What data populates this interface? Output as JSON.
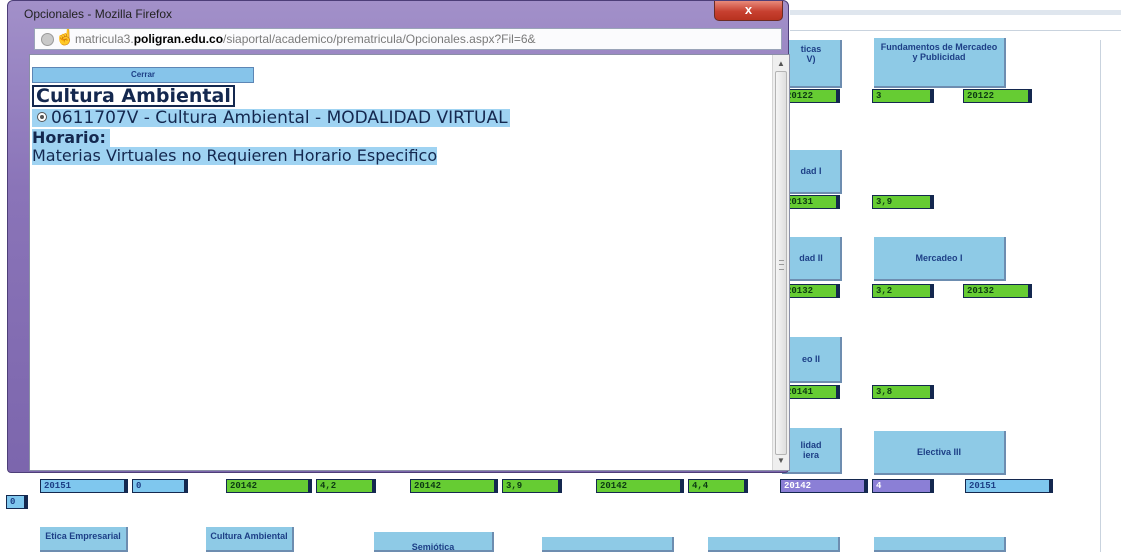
{
  "window": {
    "title": "Opcionales - Mozilla Firefox",
    "close_glyph": "x",
    "url_prefix": "matricula3.",
    "url_domain": "poligran.edu.co",
    "url_path": "/siaportal/academico/prematricula/Opcionales.aspx?Fil=6&"
  },
  "popup": {
    "close_button": "Cerrar",
    "subject_title": "Cultura Ambiental",
    "option_text": "0611707V - Cultura Ambiental - MODALIDAD VIRTUAL",
    "schedule_label": "Horario:",
    "schedule_note": "Materias Virtuales no Requieren Horario Especifico"
  },
  "background": {
    "course_labels": {
      "c1": "ticas\nV)",
      "c2": "Fundamentos de Mercadeo y Publicidad",
      "c3": "dad I",
      "c4": "dad II",
      "c5": "Mercadeo I",
      "c6": "eo II",
      "c7": "lidad\niera",
      "c8": "Electiva III",
      "c9": "Etica Empresarial",
      "c10": "Cultura Ambiental",
      "c11": "Semiótica"
    },
    "row1": [
      "20122",
      "3",
      "20122"
    ],
    "row2": [
      "20131",
      "3,9"
    ],
    "row3": [
      "20132",
      "3,2",
      "20132"
    ],
    "row4": [
      "20141",
      "3,8"
    ],
    "row5": [
      "20151",
      "0",
      "20142",
      "4,2",
      "20142",
      "3,9",
      "20142",
      "4,4",
      "20142",
      "4",
      "20151"
    ],
    "row6": [
      "0"
    ]
  },
  "colors": {
    "course_bg": "#8ecae6",
    "green_cell": "#66cc33",
    "blue_cell": "#7fc7ee",
    "purple_cell": "#8b7fd6",
    "window_frame": "#8a74b8",
    "close_red": "#c74030"
  }
}
